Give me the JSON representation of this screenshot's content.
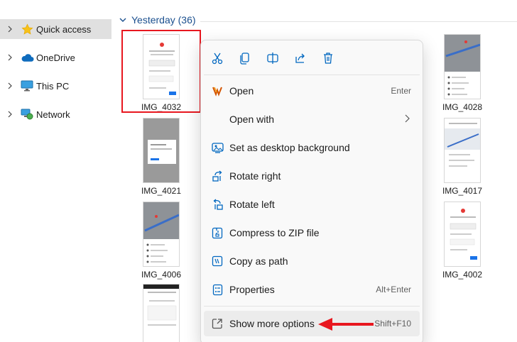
{
  "nav": {
    "items": [
      {
        "label": "Quick access",
        "icon": "star-icon",
        "selected": true
      },
      {
        "label": "OneDrive",
        "icon": "cloud-icon",
        "selected": false
      },
      {
        "label": "This PC",
        "icon": "monitor-icon",
        "selected": false
      },
      {
        "label": "Network",
        "icon": "network-icon",
        "selected": false
      }
    ]
  },
  "group": {
    "label": "Yesterday (36)"
  },
  "thumbnails": [
    {
      "label": "IMG_4032",
      "selected": true
    },
    {
      "label": "IMG_4028"
    },
    {
      "label": "IMG_4021"
    },
    {
      "label": "IMG_4017"
    },
    {
      "label": "IMG_4006"
    },
    {
      "label": "IMG_4002"
    }
  ],
  "context_menu": {
    "toolbar": [
      "cut-icon",
      "copy-icon",
      "rename-icon",
      "share-icon",
      "delete-icon"
    ],
    "items": [
      {
        "label": "Open",
        "shortcut": "Enter",
        "icon": "photos-app-icon"
      },
      {
        "label": "Open with",
        "shortcut": "",
        "icon": "",
        "submenu": true
      },
      {
        "label": "Set as desktop background",
        "shortcut": "",
        "icon": "desktop-background-icon"
      },
      {
        "label": "Rotate right",
        "shortcut": "",
        "icon": "rotate-right-icon"
      },
      {
        "label": "Rotate left",
        "shortcut": "",
        "icon": "rotate-left-icon"
      },
      {
        "label": "Compress to ZIP file",
        "shortcut": "",
        "icon": "zip-icon"
      },
      {
        "label": "Copy as path",
        "shortcut": "",
        "icon": "copy-path-icon"
      },
      {
        "label": "Properties",
        "shortcut": "Alt+Enter",
        "icon": "properties-icon"
      },
      {
        "label": "Show more options",
        "shortcut": "Shift+F10",
        "icon": "show-more-icon"
      }
    ]
  },
  "colors": {
    "accent": "#0067c0",
    "highlight": "#e8171f",
    "group_header": "#1a4f8e"
  }
}
